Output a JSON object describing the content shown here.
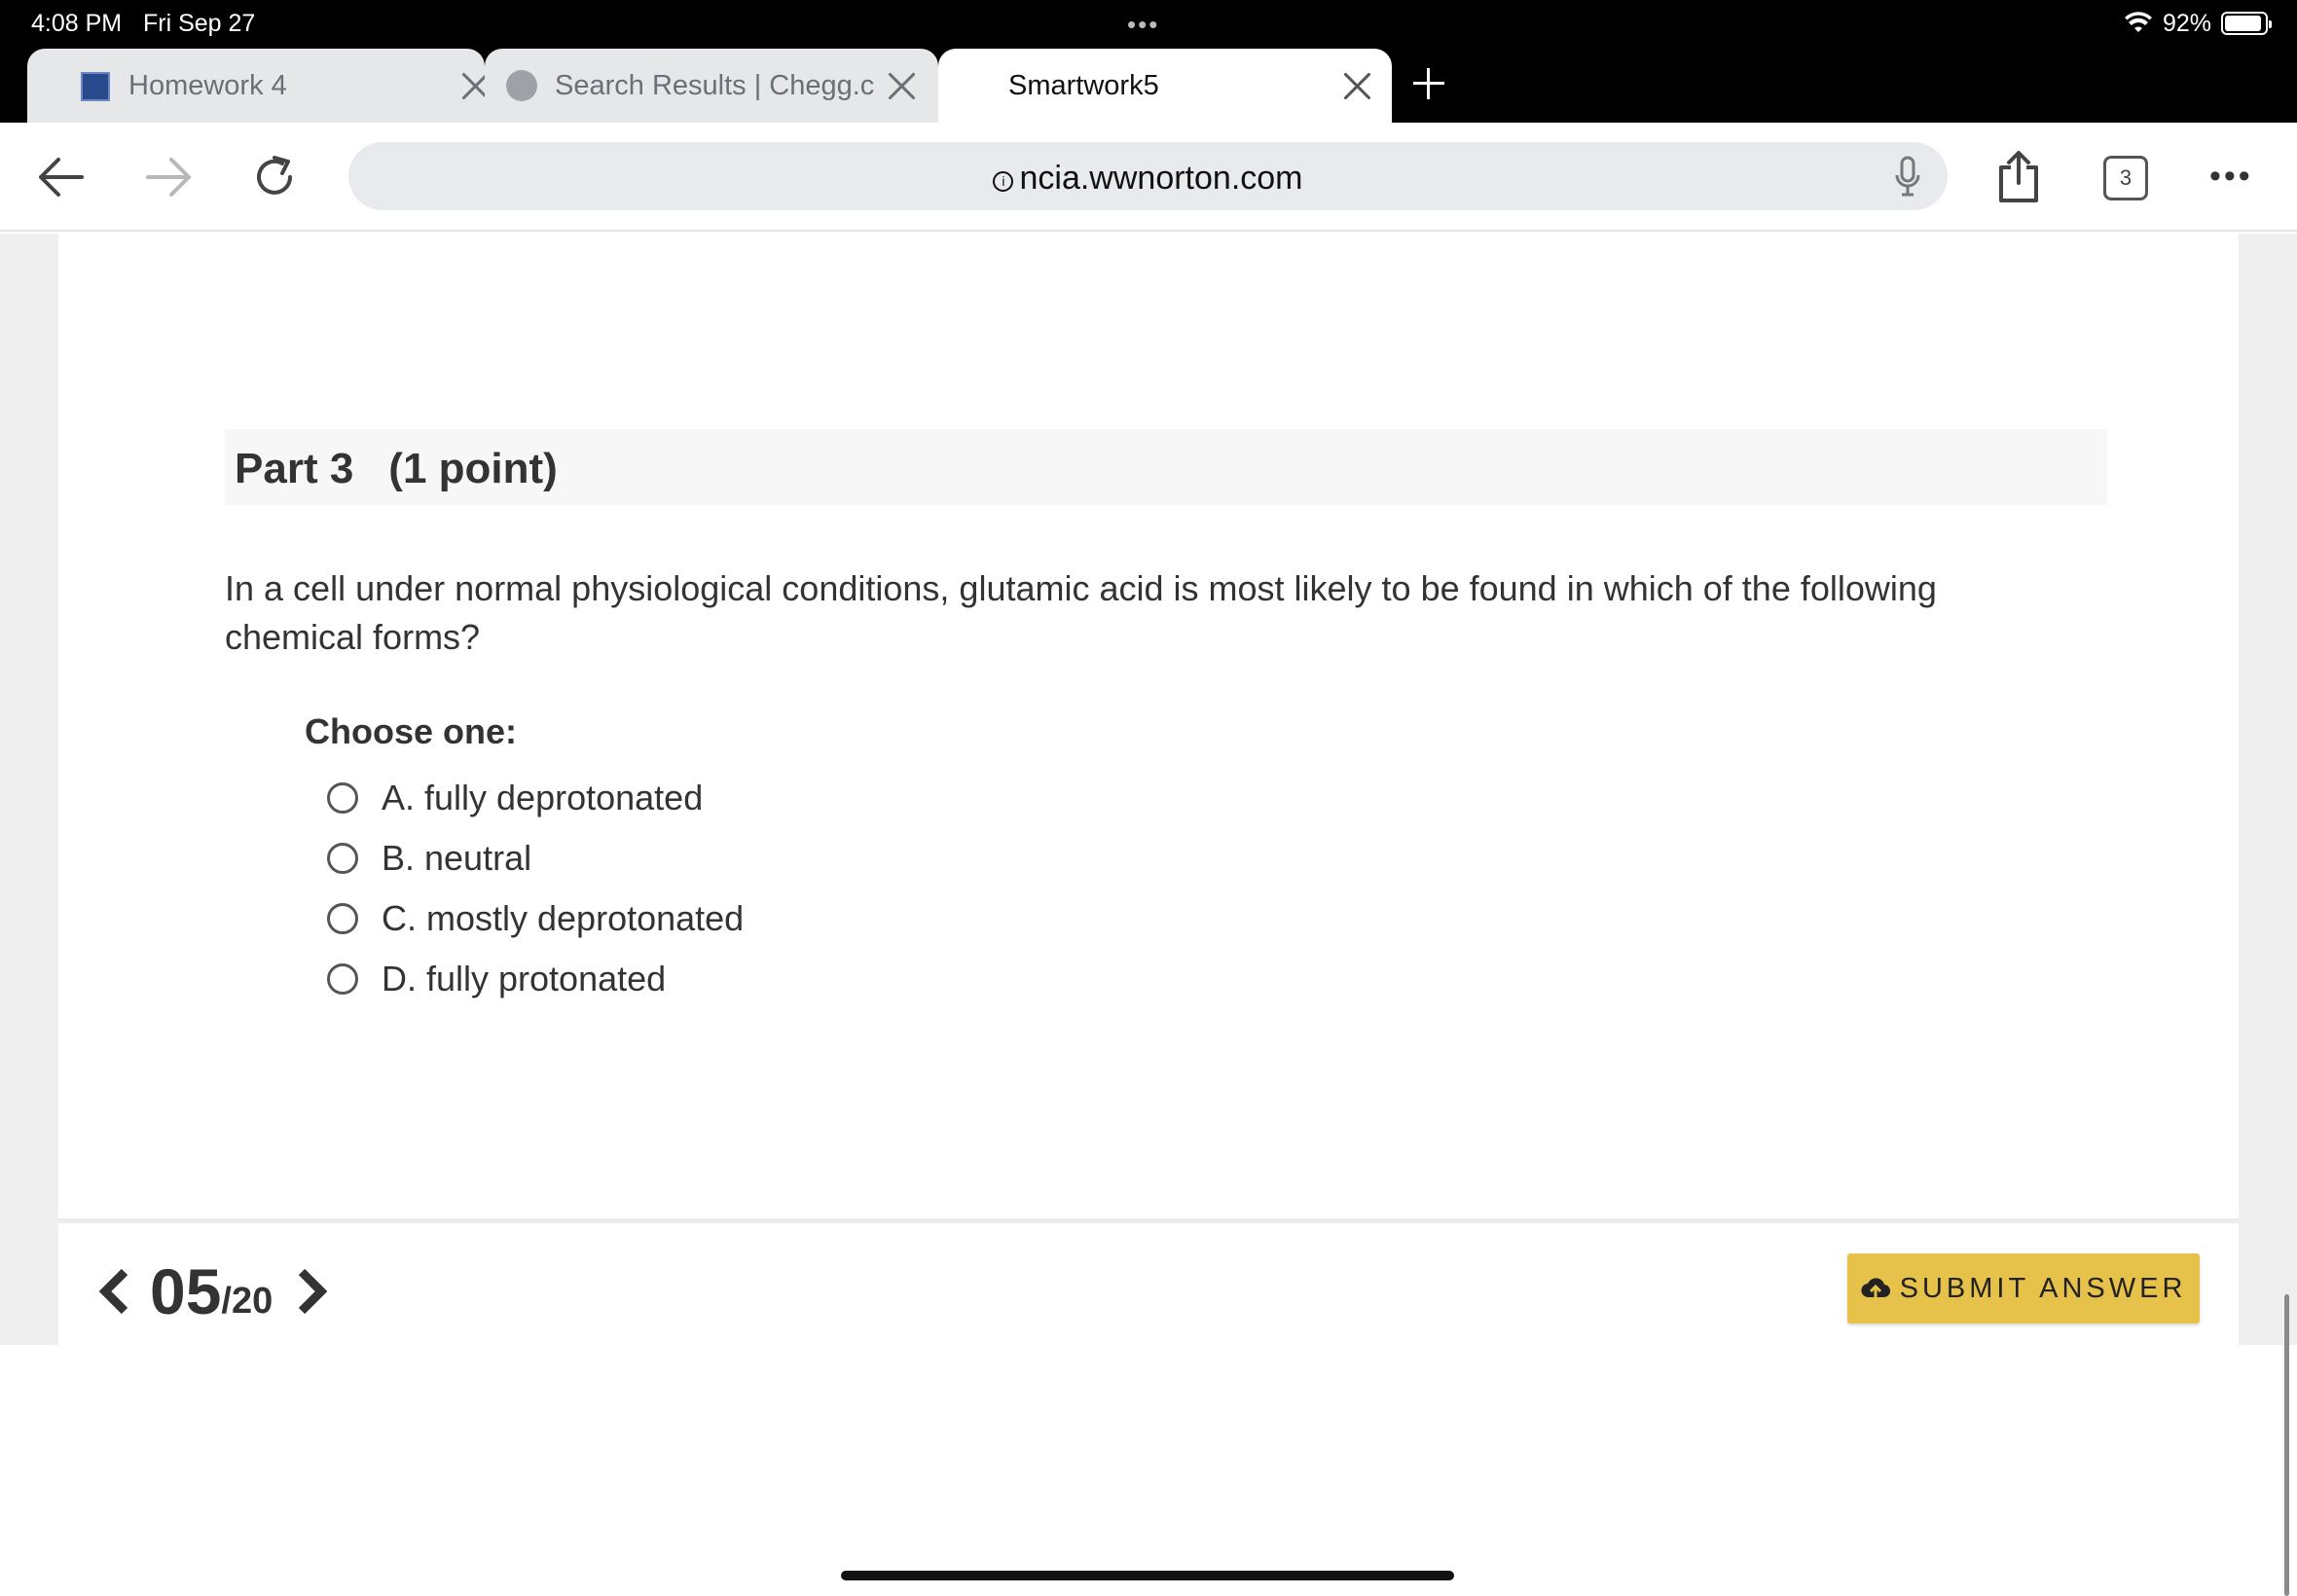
{
  "status_bar": {
    "time": "4:08 PM",
    "date": "Fri Sep 27",
    "battery": "92%",
    "battery_level": 0.92
  },
  "tabs": [
    {
      "title": "Homework 4",
      "icon": "shield-favicon",
      "active": false
    },
    {
      "title": "Search Results | Chegg.c",
      "icon": "globe-favicon",
      "active": false
    },
    {
      "title": "Smartwork5",
      "icon": "",
      "active": true
    }
  ],
  "toolbar": {
    "url": "ncia.wwnorton.com",
    "tab_count": "3"
  },
  "question": {
    "part": "Part 3",
    "points": "(1 point)",
    "text": "In a cell under normal physiological conditions, glutamic acid is most likely to be found in which of the following chemical forms?",
    "choose_label": "Choose one:",
    "options": [
      {
        "label": "A. fully deprotonated"
      },
      {
        "label": "B. neutral"
      },
      {
        "label": "C. mostly deprotonated"
      },
      {
        "label": "D. fully protonated"
      }
    ]
  },
  "footer": {
    "current": "05",
    "total": "/20",
    "submit_label": "SUBMIT ANSWER"
  },
  "colors": {
    "submit_bg": "#e6c24a",
    "tab_strip": "#000000",
    "part_header_bg": "#f7f7f7"
  }
}
